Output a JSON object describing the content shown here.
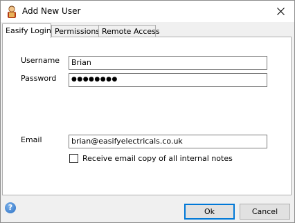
{
  "window": {
    "title": "Add New User"
  },
  "tabs": [
    {
      "label": "Easify Login",
      "active": true
    },
    {
      "label": "Permissions",
      "active": false
    },
    {
      "label": "Remote Access",
      "active": false
    }
  ],
  "form": {
    "username_label": "Username",
    "username_value": "Brian",
    "password_label": "Password",
    "password_value": "●●●●●●●●",
    "email_label": "Email",
    "email_value": "brian@easifyelectricals.co.uk",
    "copy_notes_label": "Receive email copy of all internal notes",
    "copy_notes_checked": false
  },
  "footer": {
    "help_icon": "help-icon",
    "ok_label": "Ok",
    "cancel_label": "Cancel"
  }
}
